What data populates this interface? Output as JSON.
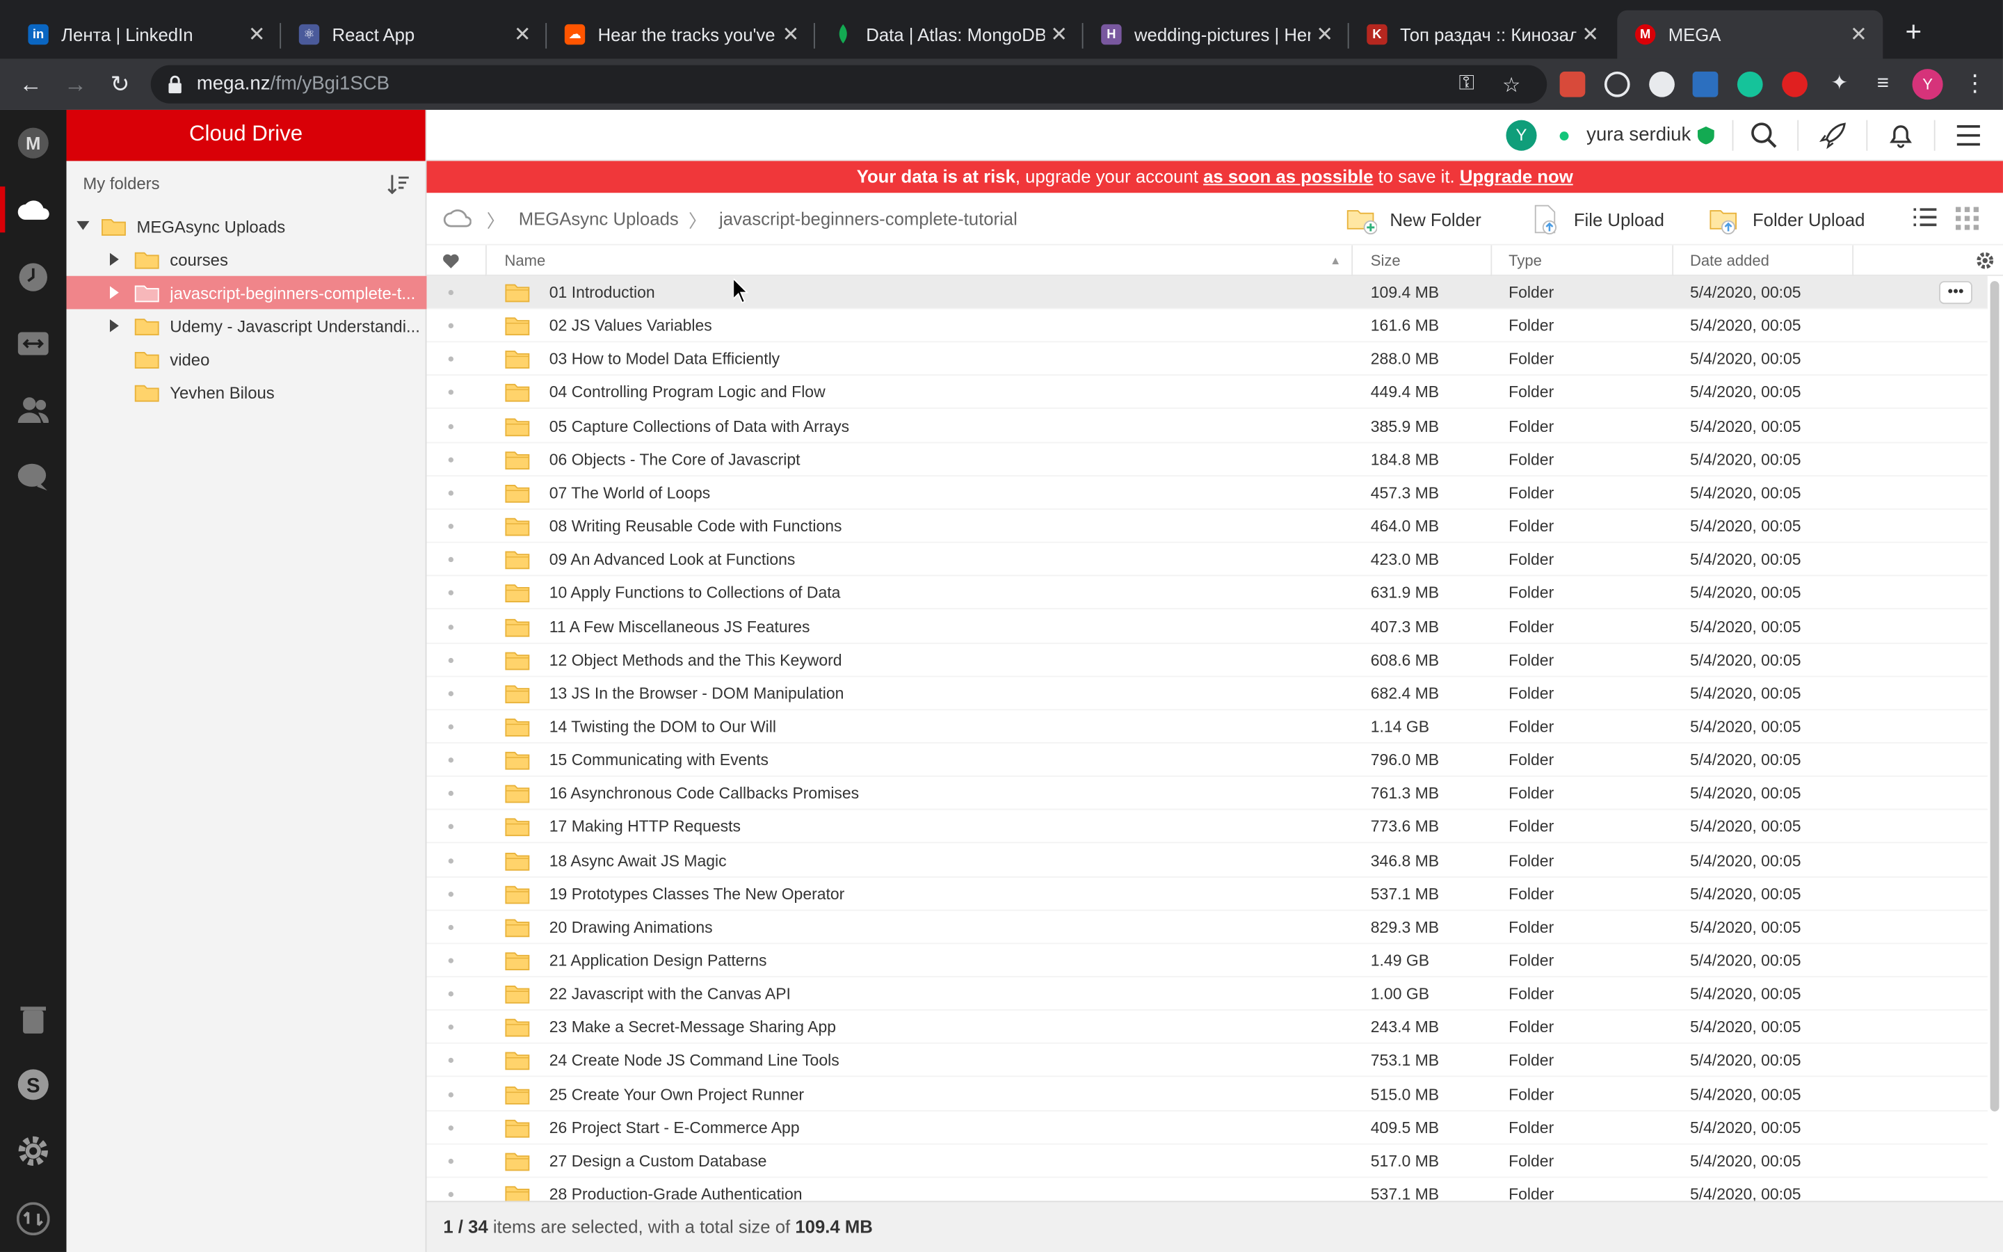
{
  "browser": {
    "tabs": [
      {
        "title": "Лента | LinkedIn",
        "icon": "linkedin-icon",
        "color": "#0a66c2"
      },
      {
        "title": "React App",
        "icon": "react-app-icon",
        "color": "#4a5a9a"
      },
      {
        "title": "Hear the tracks you've",
        "icon": "soundcloud-icon",
        "color": "#ff5500"
      },
      {
        "title": "Data | Atlas: MongoDB",
        "icon": "mongodb-leaf-icon",
        "color": "#13aa52"
      },
      {
        "title": "wedding-pictures | Her",
        "icon": "heroku-icon",
        "color": "#79589f"
      },
      {
        "title": "Топ раздач :: Кинозал",
        "icon": "kinozal-icon",
        "color": "#b5271f"
      },
      {
        "title": "MEGA",
        "icon": "mega-icon",
        "color": "#d90007"
      }
    ],
    "url_host": "mega.nz",
    "url_path": "/fm/yBgi1SCB",
    "profile_initial": "Y"
  },
  "sidebar": {
    "title": "Cloud Drive",
    "subtitle": "My folders",
    "tree": [
      {
        "label": "MEGAsync Uploads",
        "level": 0,
        "expanded": true
      },
      {
        "label": "courses",
        "level": 1,
        "expandable": true
      },
      {
        "label": "javascript-beginners-complete-t...",
        "level": 1,
        "expandable": true,
        "selected": true
      },
      {
        "label": "Udemy - Javascript Understandi...",
        "level": 1,
        "expandable": true
      },
      {
        "label": "video",
        "level": 1
      },
      {
        "label": "Yevhen Bilous",
        "level": 1
      }
    ]
  },
  "topbar": {
    "avatar_initial": "Y",
    "user_name": "yura serdiuk"
  },
  "banner": {
    "part1": "Your data is at risk",
    "part2": ", upgrade your account ",
    "part3": "as soon as possible",
    "part4": " to save it. ",
    "part5": "Upgrade now"
  },
  "breadcrumb": {
    "parent": "MEGAsync Uploads",
    "current": "javascript-beginners-complete-tutorial"
  },
  "toolbar": {
    "new_folder": "New Folder",
    "file_upload": "File Upload",
    "folder_upload": "Folder Upload"
  },
  "table": {
    "headers": {
      "name": "Name",
      "size": "Size",
      "type": "Type",
      "date": "Date added"
    },
    "rows": [
      {
        "name": "01 Introduction",
        "size": "109.4 MB",
        "type": "Folder",
        "date": "5/4/2020, 00:05"
      },
      {
        "name": "02 JS Values Variables",
        "size": "161.6 MB",
        "type": "Folder",
        "date": "5/4/2020, 00:05"
      },
      {
        "name": "03 How to Model Data Efficiently",
        "size": "288.0 MB",
        "type": "Folder",
        "date": "5/4/2020, 00:05"
      },
      {
        "name": "04 Controlling Program Logic and Flow",
        "size": "449.4 MB",
        "type": "Folder",
        "date": "5/4/2020, 00:05"
      },
      {
        "name": "05 Capture Collections of Data with Arrays",
        "size": "385.9 MB",
        "type": "Folder",
        "date": "5/4/2020, 00:05"
      },
      {
        "name": "06 Objects - The Core of Javascript",
        "size": "184.8 MB",
        "type": "Folder",
        "date": "5/4/2020, 00:05"
      },
      {
        "name": "07 The World of Loops",
        "size": "457.3 MB",
        "type": "Folder",
        "date": "5/4/2020, 00:05"
      },
      {
        "name": "08 Writing Reusable Code with Functions",
        "size": "464.0 MB",
        "type": "Folder",
        "date": "5/4/2020, 00:05"
      },
      {
        "name": "09 An Advanced Look at Functions",
        "size": "423.0 MB",
        "type": "Folder",
        "date": "5/4/2020, 00:05"
      },
      {
        "name": "10 Apply Functions to Collections of Data",
        "size": "631.9 MB",
        "type": "Folder",
        "date": "5/4/2020, 00:05"
      },
      {
        "name": "11 A Few Miscellaneous JS Features",
        "size": "407.3 MB",
        "type": "Folder",
        "date": "5/4/2020, 00:05"
      },
      {
        "name": "12 Object Methods and the This Keyword",
        "size": "608.6 MB",
        "type": "Folder",
        "date": "5/4/2020, 00:05"
      },
      {
        "name": "13 JS In the Browser - DOM Manipulation",
        "size": "682.4 MB",
        "type": "Folder",
        "date": "5/4/2020, 00:05"
      },
      {
        "name": "14 Twisting the DOM to Our Will",
        "size": "1.14 GB",
        "type": "Folder",
        "date": "5/4/2020, 00:05"
      },
      {
        "name": "15 Communicating with Events",
        "size": "796.0 MB",
        "type": "Folder",
        "date": "5/4/2020, 00:05"
      },
      {
        "name": "16 Asynchronous Code Callbacks Promises",
        "size": "761.3 MB",
        "type": "Folder",
        "date": "5/4/2020, 00:05"
      },
      {
        "name": "17 Making HTTP Requests",
        "size": "773.6 MB",
        "type": "Folder",
        "date": "5/4/2020, 00:05"
      },
      {
        "name": "18 Async Await JS Magic",
        "size": "346.8 MB",
        "type": "Folder",
        "date": "5/4/2020, 00:05"
      },
      {
        "name": "19 Prototypes Classes The New Operator",
        "size": "537.1 MB",
        "type": "Folder",
        "date": "5/4/2020, 00:05"
      },
      {
        "name": "20 Drawing Animations",
        "size": "829.3 MB",
        "type": "Folder",
        "date": "5/4/2020, 00:05"
      },
      {
        "name": "21 Application Design Patterns",
        "size": "1.49 GB",
        "type": "Folder",
        "date": "5/4/2020, 00:05"
      },
      {
        "name": "22 Javascript with the Canvas API",
        "size": "1.00 GB",
        "type": "Folder",
        "date": "5/4/2020, 00:05"
      },
      {
        "name": "23 Make a Secret-Message Sharing App",
        "size": "243.4 MB",
        "type": "Folder",
        "date": "5/4/2020, 00:05"
      },
      {
        "name": "24 Create Node JS Command Line Tools",
        "size": "753.1 MB",
        "type": "Folder",
        "date": "5/4/2020, 00:05"
      },
      {
        "name": "25 Create Your Own Project Runner",
        "size": "515.0 MB",
        "type": "Folder",
        "date": "5/4/2020, 00:05"
      },
      {
        "name": "26 Project Start - E-Commerce App",
        "size": "409.5 MB",
        "type": "Folder",
        "date": "5/4/2020, 00:05"
      },
      {
        "name": "27 Design a Custom Database",
        "size": "517.0 MB",
        "type": "Folder",
        "date": "5/4/2020, 00:05"
      },
      {
        "name": "28 Production-Grade Authentication",
        "size": "537.1 MB",
        "type": "Folder",
        "date": "5/4/2020, 00:05"
      }
    ]
  },
  "status": {
    "selected": "1",
    "total": "/ 34",
    "text": " items are selected, with a total size of ",
    "size": "109.4 MB"
  },
  "colors": {
    "brand": "#d90007",
    "banner": "#f0373a",
    "folder": "#ffd36b",
    "selected_tree": "#f0858a"
  }
}
